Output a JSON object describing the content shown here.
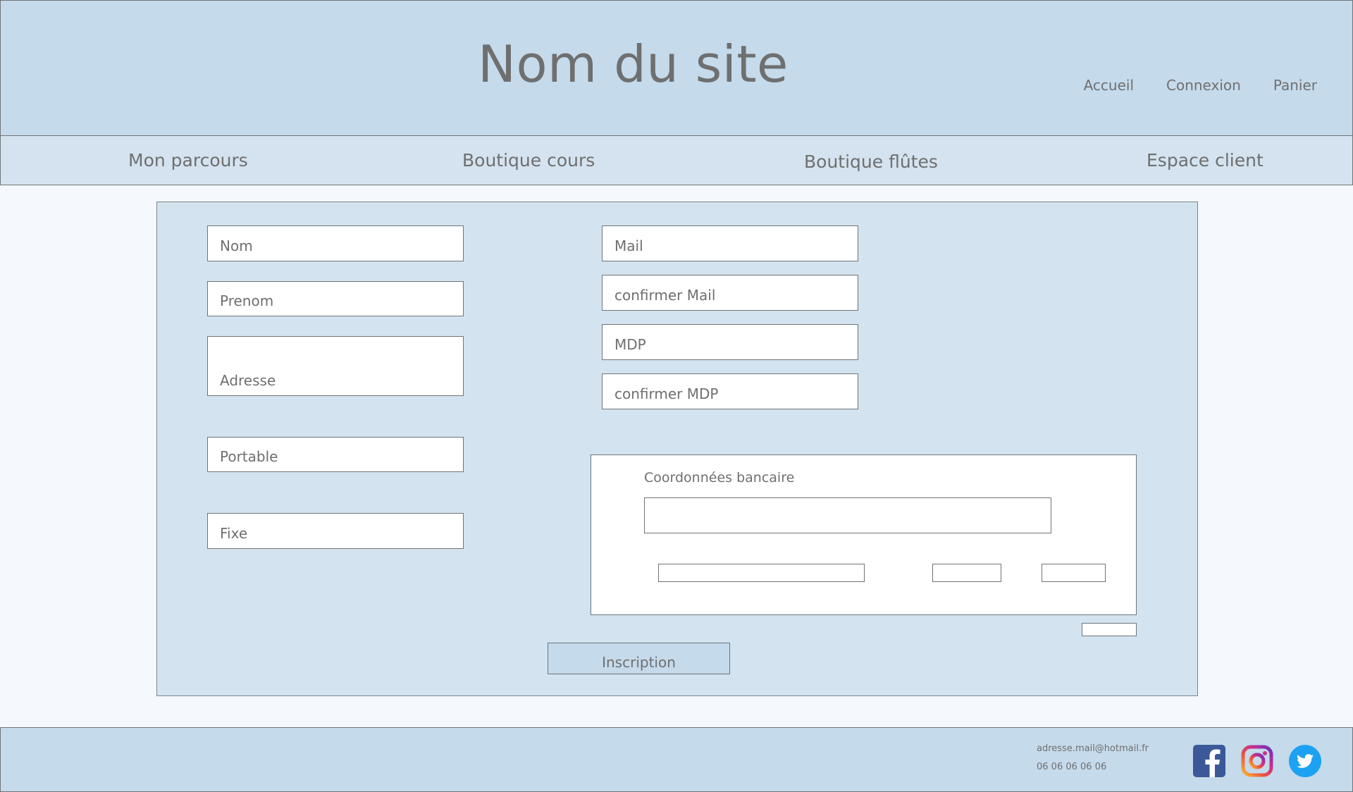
{
  "header": {
    "site_title": "Nom du site",
    "links": {
      "home": "Accueil",
      "login": "Connexion",
      "cart": "Panier"
    }
  },
  "nav": {
    "journey": "Mon parcours",
    "courses_shop": "Boutique cours",
    "flutes_shop": "Boutique flûtes",
    "client_area": "Espace client"
  },
  "form": {
    "last_name": "Nom",
    "first_name": "Prenom",
    "address": "Adresse",
    "mobile": "Portable",
    "landline": "Fixe",
    "email": "Mail",
    "confirm_email": "confirmer Mail",
    "password": "MDP",
    "confirm_password": "confirmer MDP",
    "bank": {
      "title": "Coordonnées bancaire"
    },
    "submit": "Inscription"
  },
  "footer": {
    "email": "adresse.mail@hotmail.fr",
    "phone": "06 06 06 06 06"
  },
  "icons": [
    "facebook-icon",
    "instagram-icon",
    "twitter-icon"
  ],
  "colors": {
    "header_bg": "#c5daeb",
    "nav_bg": "#d4e3ef",
    "panel_bg": "#d3e3ef",
    "page_bg": "#f5f9fd",
    "facebook": "#3b5998",
    "twitter": "#1da1f2"
  }
}
